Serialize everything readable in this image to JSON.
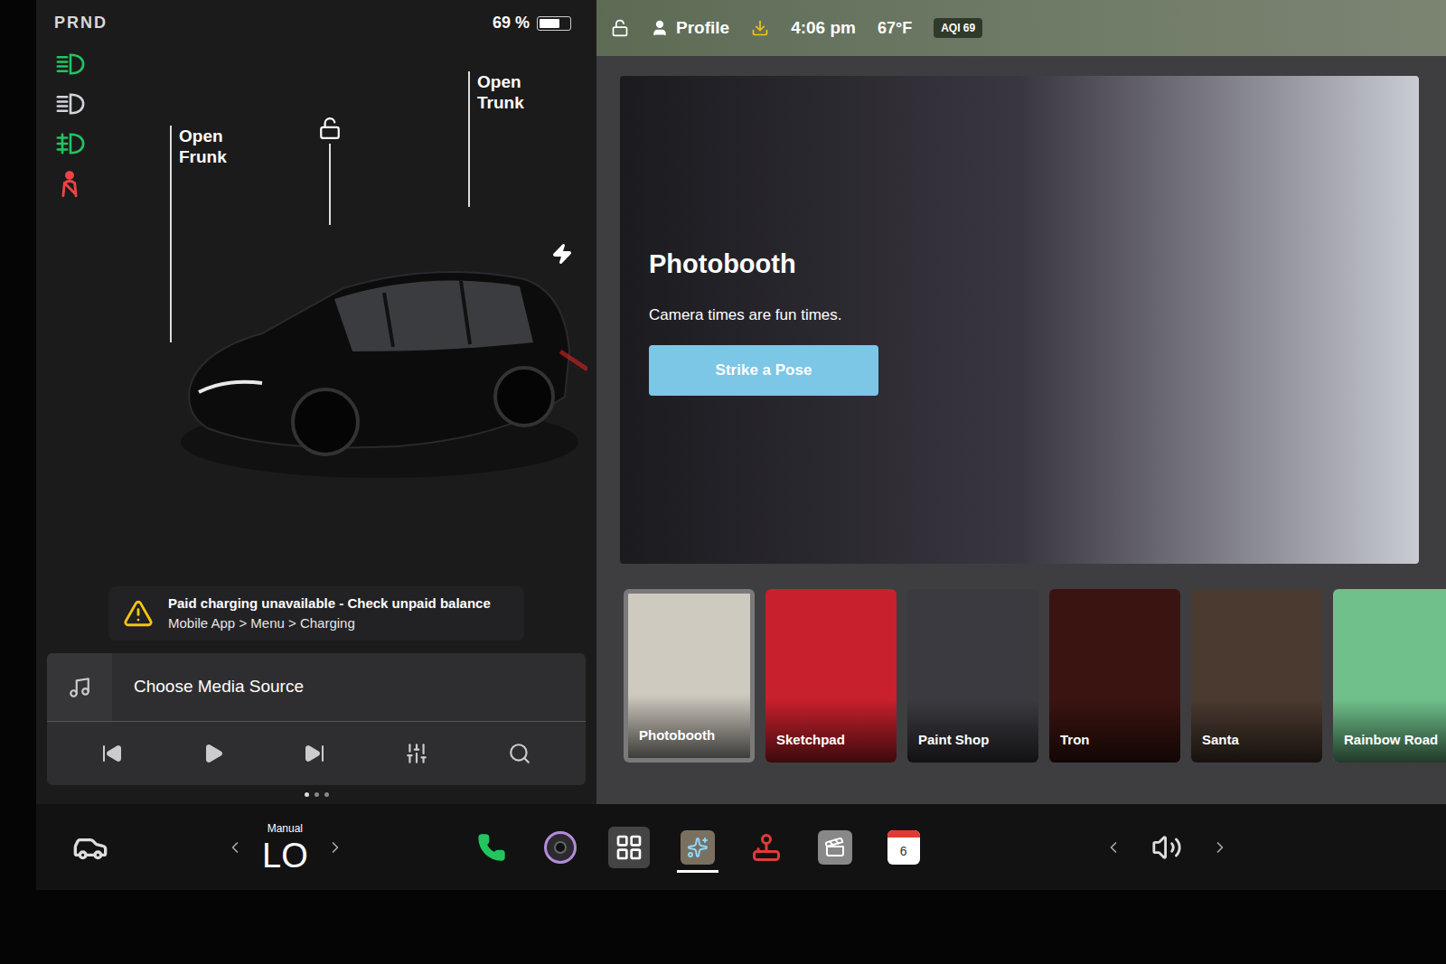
{
  "shift": "PRND",
  "battery": {
    "percent": "69 %",
    "level": 0.69
  },
  "indicators": [
    {
      "kind": "headlight",
      "color": "#22c55e"
    },
    {
      "kind": "auto-headlight",
      "color": "#d1d5db"
    },
    {
      "kind": "fog-light",
      "color": "#22c55e"
    },
    {
      "kind": "seatbelt",
      "color": "#ef4444"
    }
  ],
  "car": {
    "frunk_label": "Open Frunk",
    "trunk_label": "Open Trunk",
    "locked": false,
    "charging": true
  },
  "alert": {
    "title": "Paid charging unavailable - Check unpaid balance",
    "subtitle": "Mobile App > Menu > Charging"
  },
  "media": {
    "title": "Choose Media Source",
    "playing": false
  },
  "dots": [
    {
      "selected": true
    },
    {
      "selected": false
    },
    {
      "selected": false
    }
  ],
  "status_bar": {
    "locked": false,
    "profile": "Profile",
    "time": "4:06 pm",
    "temperature": "67°F",
    "aqi": "AQI 69"
  },
  "hero": {
    "title": "Photobooth",
    "subtitle": "Camera times are fun times.",
    "button": "Strike a Pose"
  },
  "tiles": [
    {
      "label": "Photobooth",
      "color": "#cfcac0",
      "selected": true
    },
    {
      "label": "Sketchpad",
      "color": "#c8202c",
      "selected": false
    },
    {
      "label": "Paint Shop",
      "color": "#3a3a40",
      "selected": false
    },
    {
      "label": "Tron",
      "color": "#3a1410",
      "selected": false
    },
    {
      "label": "Santa",
      "color": "#4a3a30",
      "selected": false
    },
    {
      "label": "Rainbow Road",
      "color": "#6fc08a",
      "selected": false
    }
  ],
  "dock": {
    "climate_mode": "Manual",
    "temperature": "LO",
    "calendar_day": "6",
    "apps": [
      {
        "kind": "phone",
        "selected": false
      },
      {
        "kind": "camera",
        "selected": false
      },
      {
        "kind": "launcher",
        "selected": false
      },
      {
        "kind": "toybox",
        "selected": true
      },
      {
        "kind": "arcade",
        "selected": false
      },
      {
        "kind": "theater",
        "selected": false
      },
      {
        "kind": "calendar",
        "selected": false
      }
    ]
  }
}
